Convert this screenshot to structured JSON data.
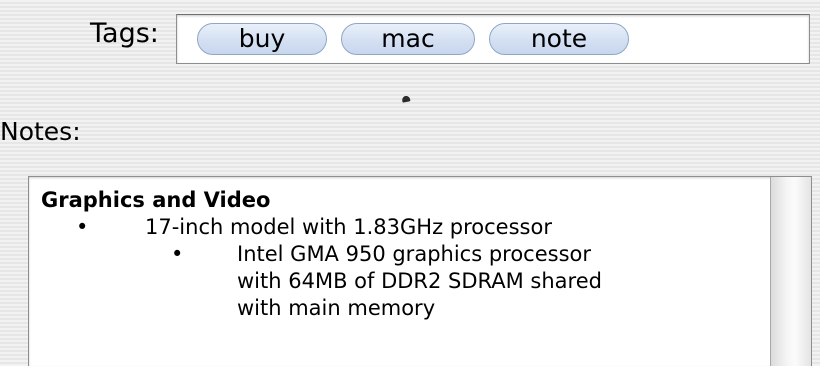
{
  "tags": {
    "label": "Tags:",
    "items": [
      "buy",
      "mac",
      "note"
    ]
  },
  "notes": {
    "label": "Notes:",
    "heading": "Graphics and Video",
    "bullets": [
      {
        "level": 1,
        "text": "17-inch model with 1.83GHz processor"
      },
      {
        "level": 2,
        "text": "Intel GMA 950 graphics processor with 64MB of DDR2 SDRAM shared with main memory"
      }
    ]
  },
  "colors": {
    "tag_fill": "#d4e0f2",
    "tag_border": "#8fa6c7",
    "panel_background": "#ececec"
  }
}
